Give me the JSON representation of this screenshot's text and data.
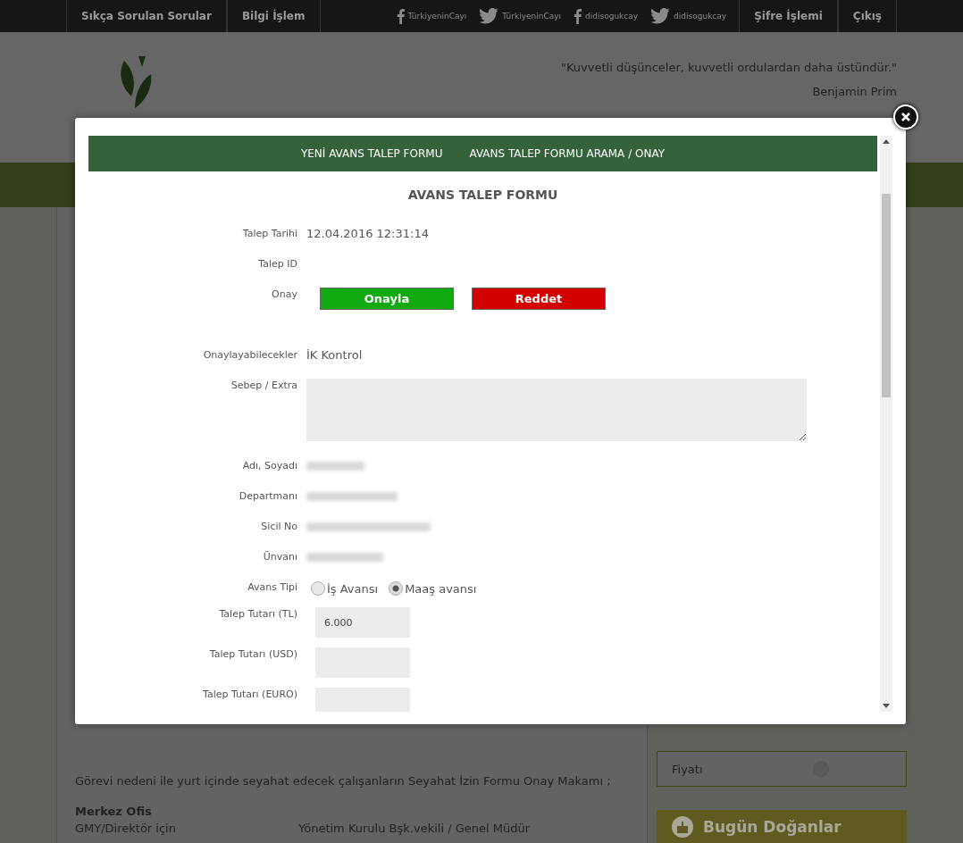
{
  "top_bar": {
    "left_links": [
      "Sıkça Sorulan Sorular",
      "Bilgi İşlem"
    ],
    "social": [
      {
        "kind": "facebook",
        "label": "TürkiyeninCayı"
      },
      {
        "kind": "twitter",
        "label": "TürkiyeninCayı"
      },
      {
        "kind": "facebook",
        "label": "didisogukcay"
      },
      {
        "kind": "twitter",
        "label": "didisogukcay"
      }
    ],
    "right_links": [
      "Şifre İşlemi",
      "Çıkış"
    ]
  },
  "header": {
    "quote": "\"Kuvvetli düşünceler, kuvvetli ordulardan daha üstündür.\"",
    "author": "Benjamin Prim"
  },
  "content": {
    "paragraph": "Görevi nedeni ile yurt içinde seyahat edecek çalışanların Seyahat İzin Formu Onay Makamı ;",
    "heading": "Merkez Ofis",
    "rows": [
      {
        "role": "GMY/Direktör için",
        "approver": "Yönetim Kurulu Bşk.vekili / Genel Müdür"
      }
    ]
  },
  "sidebar": {
    "options": [
      {
        "label": "Fiyatı",
        "checked": false
      }
    ],
    "birthdays_title": "Bugün Doğanlar"
  },
  "modal": {
    "tabs": [
      "YENİ AVANS TALEP FORMU",
      "AVANS TALEP FORMU ARAMA / ONAY"
    ],
    "form_title": "AVANS TALEP FORMU",
    "fields": [
      {
        "kind": "text",
        "label": "Talep Tarihi",
        "value": "12.04.2016 12:31:14"
      },
      {
        "kind": "text",
        "label": "Talep ID"
      },
      {
        "kind": "buttons",
        "label": "Onay",
        "approve": "Onayla",
        "reject": "Reddet"
      },
      {
        "kind": "text",
        "label": "Onaylayabilecekler",
        "value": "İK Kontrol"
      },
      {
        "kind": "textarea",
        "label": "Sebep / Extra"
      },
      {
        "kind": "blurred",
        "label": "Adı, Soyadı"
      },
      {
        "kind": "blurred",
        "label": "Departmanı"
      },
      {
        "kind": "blurred",
        "label": "Sicil No"
      },
      {
        "kind": "blurred",
        "label": "Ünvanı"
      },
      {
        "kind": "radio",
        "label": "Avans Tipi",
        "options": [
          {
            "label": "İş Avansı",
            "selected": false
          },
          {
            "label": "Maaş avansı",
            "selected": true
          }
        ]
      },
      {
        "kind": "input",
        "label": "Talep Tutarı (TL)",
        "value": "6.000"
      },
      {
        "kind": "input",
        "label": "Talep Tutarı (USD)"
      },
      {
        "kind": "input",
        "label": "Talep Tutarı (EURO)"
      }
    ]
  }
}
